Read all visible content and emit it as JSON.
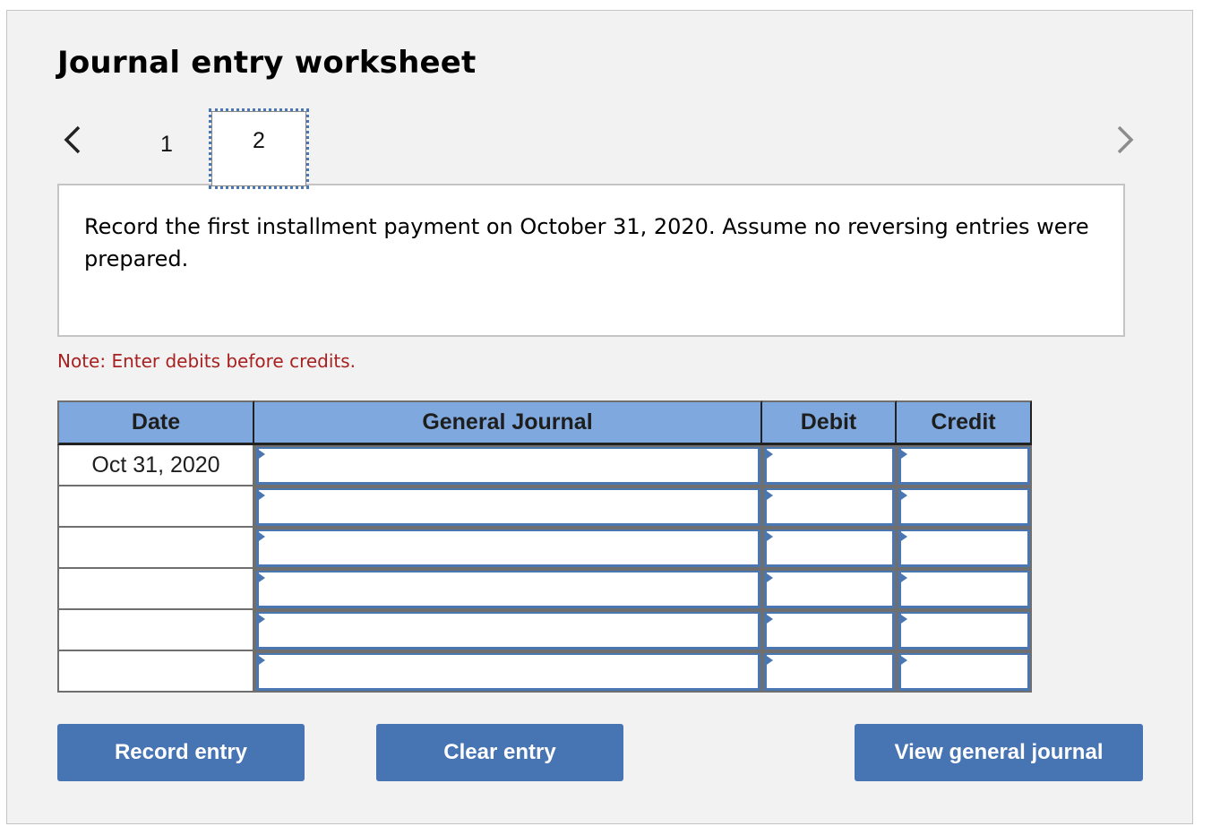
{
  "header": {
    "title": "Journal entry worksheet"
  },
  "pagination": {
    "prev_icon": "chevron-left-icon",
    "next_icon": "chevron-right-icon",
    "tabs": [
      {
        "label": "1",
        "active": false
      },
      {
        "label": "2",
        "active": true
      }
    ]
  },
  "question": {
    "text": "Record the first installment payment on October 31, 2020. Assume no reversing entries were prepared."
  },
  "note": "Note: Enter debits before credits.",
  "table": {
    "columns": [
      "Date",
      "General Journal",
      "Debit",
      "Credit"
    ],
    "rows": [
      {
        "date": "Oct 31, 2020",
        "account": "",
        "debit": "",
        "credit": ""
      },
      {
        "date": "",
        "account": "",
        "debit": "",
        "credit": ""
      },
      {
        "date": "",
        "account": "",
        "debit": "",
        "credit": ""
      },
      {
        "date": "",
        "account": "",
        "debit": "",
        "credit": ""
      },
      {
        "date": "",
        "account": "",
        "debit": "",
        "credit": ""
      },
      {
        "date": "",
        "account": "",
        "debit": "",
        "credit": ""
      }
    ]
  },
  "buttons": {
    "record": "Record entry",
    "clear": "Clear entry",
    "view": "View general journal"
  },
  "colors": {
    "header_bg": "#7fa9de",
    "button_bg": "#4774b2",
    "note_color": "#a82020",
    "input_border": "#4a76b2"
  }
}
